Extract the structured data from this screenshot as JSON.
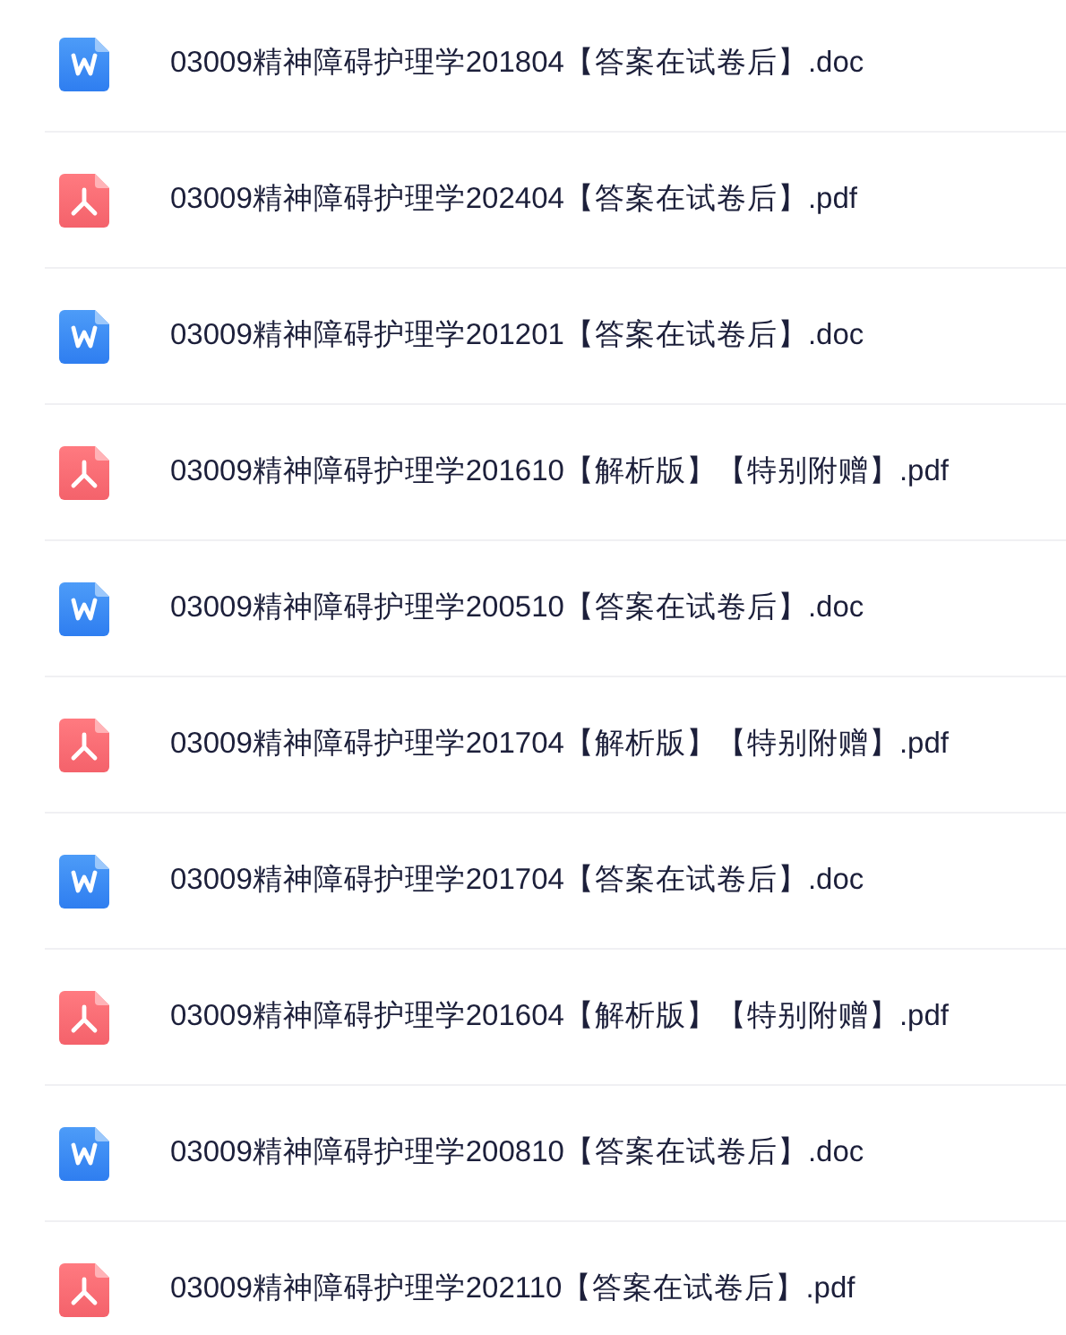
{
  "files": [
    {
      "kind": "doc",
      "name": "03009精神障碍护理学201804【答案在试卷后】.doc"
    },
    {
      "kind": "pdf",
      "name": "03009精神障碍护理学202404【答案在试卷后】.pdf"
    },
    {
      "kind": "doc",
      "name": "03009精神障碍护理学201201【答案在试卷后】.doc"
    },
    {
      "kind": "pdf",
      "name": "03009精神障碍护理学201610【解析版】【特别附赠】.pdf"
    },
    {
      "kind": "doc",
      "name": "03009精神障碍护理学200510【答案在试卷后】.doc"
    },
    {
      "kind": "pdf",
      "name": "03009精神障碍护理学201704【解析版】【特别附赠】.pdf"
    },
    {
      "kind": "doc",
      "name": "03009精神障碍护理学201704【答案在试卷后】.doc"
    },
    {
      "kind": "pdf",
      "name": "03009精神障碍护理学201604【解析版】【特别附赠】.pdf"
    },
    {
      "kind": "doc",
      "name": "03009精神障碍护理学200810【答案在试卷后】.doc"
    },
    {
      "kind": "pdf",
      "name": "03009精神障碍护理学202110【答案在试卷后】.pdf"
    }
  ]
}
